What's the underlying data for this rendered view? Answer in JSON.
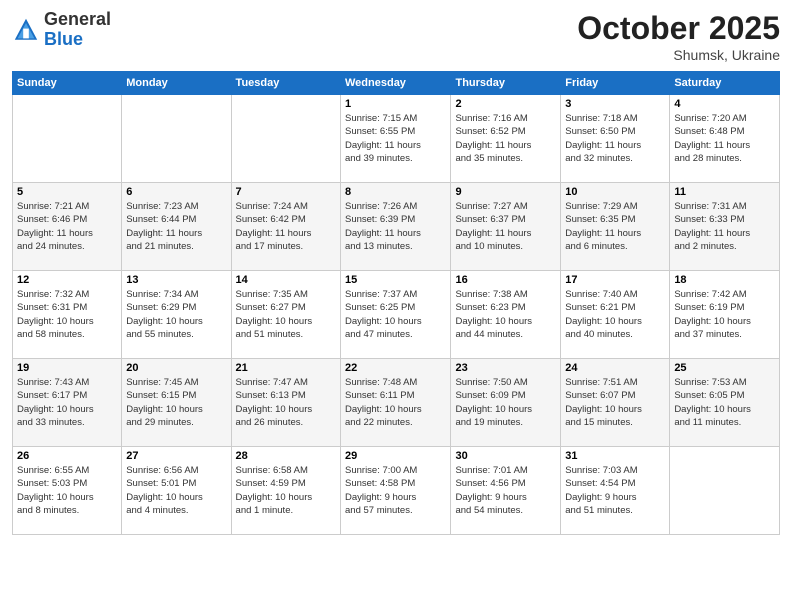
{
  "header": {
    "logo_general": "General",
    "logo_blue": "Blue",
    "month_title": "October 2025",
    "location": "Shumsk, Ukraine"
  },
  "days_of_week": [
    "Sunday",
    "Monday",
    "Tuesday",
    "Wednesday",
    "Thursday",
    "Friday",
    "Saturday"
  ],
  "weeks": [
    [
      {
        "day": "",
        "info": ""
      },
      {
        "day": "",
        "info": ""
      },
      {
        "day": "",
        "info": ""
      },
      {
        "day": "1",
        "info": "Sunrise: 7:15 AM\nSunset: 6:55 PM\nDaylight: 11 hours\nand 39 minutes."
      },
      {
        "day": "2",
        "info": "Sunrise: 7:16 AM\nSunset: 6:52 PM\nDaylight: 11 hours\nand 35 minutes."
      },
      {
        "day": "3",
        "info": "Sunrise: 7:18 AM\nSunset: 6:50 PM\nDaylight: 11 hours\nand 32 minutes."
      },
      {
        "day": "4",
        "info": "Sunrise: 7:20 AM\nSunset: 6:48 PM\nDaylight: 11 hours\nand 28 minutes."
      }
    ],
    [
      {
        "day": "5",
        "info": "Sunrise: 7:21 AM\nSunset: 6:46 PM\nDaylight: 11 hours\nand 24 minutes."
      },
      {
        "day": "6",
        "info": "Sunrise: 7:23 AM\nSunset: 6:44 PM\nDaylight: 11 hours\nand 21 minutes."
      },
      {
        "day": "7",
        "info": "Sunrise: 7:24 AM\nSunset: 6:42 PM\nDaylight: 11 hours\nand 17 minutes."
      },
      {
        "day": "8",
        "info": "Sunrise: 7:26 AM\nSunset: 6:39 PM\nDaylight: 11 hours\nand 13 minutes."
      },
      {
        "day": "9",
        "info": "Sunrise: 7:27 AM\nSunset: 6:37 PM\nDaylight: 11 hours\nand 10 minutes."
      },
      {
        "day": "10",
        "info": "Sunrise: 7:29 AM\nSunset: 6:35 PM\nDaylight: 11 hours\nand 6 minutes."
      },
      {
        "day": "11",
        "info": "Sunrise: 7:31 AM\nSunset: 6:33 PM\nDaylight: 11 hours\nand 2 minutes."
      }
    ],
    [
      {
        "day": "12",
        "info": "Sunrise: 7:32 AM\nSunset: 6:31 PM\nDaylight: 10 hours\nand 58 minutes."
      },
      {
        "day": "13",
        "info": "Sunrise: 7:34 AM\nSunset: 6:29 PM\nDaylight: 10 hours\nand 55 minutes."
      },
      {
        "day": "14",
        "info": "Sunrise: 7:35 AM\nSunset: 6:27 PM\nDaylight: 10 hours\nand 51 minutes."
      },
      {
        "day": "15",
        "info": "Sunrise: 7:37 AM\nSunset: 6:25 PM\nDaylight: 10 hours\nand 47 minutes."
      },
      {
        "day": "16",
        "info": "Sunrise: 7:38 AM\nSunset: 6:23 PM\nDaylight: 10 hours\nand 44 minutes."
      },
      {
        "day": "17",
        "info": "Sunrise: 7:40 AM\nSunset: 6:21 PM\nDaylight: 10 hours\nand 40 minutes."
      },
      {
        "day": "18",
        "info": "Sunrise: 7:42 AM\nSunset: 6:19 PM\nDaylight: 10 hours\nand 37 minutes."
      }
    ],
    [
      {
        "day": "19",
        "info": "Sunrise: 7:43 AM\nSunset: 6:17 PM\nDaylight: 10 hours\nand 33 minutes."
      },
      {
        "day": "20",
        "info": "Sunrise: 7:45 AM\nSunset: 6:15 PM\nDaylight: 10 hours\nand 29 minutes."
      },
      {
        "day": "21",
        "info": "Sunrise: 7:47 AM\nSunset: 6:13 PM\nDaylight: 10 hours\nand 26 minutes."
      },
      {
        "day": "22",
        "info": "Sunrise: 7:48 AM\nSunset: 6:11 PM\nDaylight: 10 hours\nand 22 minutes."
      },
      {
        "day": "23",
        "info": "Sunrise: 7:50 AM\nSunset: 6:09 PM\nDaylight: 10 hours\nand 19 minutes."
      },
      {
        "day": "24",
        "info": "Sunrise: 7:51 AM\nSunset: 6:07 PM\nDaylight: 10 hours\nand 15 minutes."
      },
      {
        "day": "25",
        "info": "Sunrise: 7:53 AM\nSunset: 6:05 PM\nDaylight: 10 hours\nand 11 minutes."
      }
    ],
    [
      {
        "day": "26",
        "info": "Sunrise: 6:55 AM\nSunset: 5:03 PM\nDaylight: 10 hours\nand 8 minutes."
      },
      {
        "day": "27",
        "info": "Sunrise: 6:56 AM\nSunset: 5:01 PM\nDaylight: 10 hours\nand 4 minutes."
      },
      {
        "day": "28",
        "info": "Sunrise: 6:58 AM\nSunset: 4:59 PM\nDaylight: 10 hours\nand 1 minute."
      },
      {
        "day": "29",
        "info": "Sunrise: 7:00 AM\nSunset: 4:58 PM\nDaylight: 9 hours\nand 57 minutes."
      },
      {
        "day": "30",
        "info": "Sunrise: 7:01 AM\nSunset: 4:56 PM\nDaylight: 9 hours\nand 54 minutes."
      },
      {
        "day": "31",
        "info": "Sunrise: 7:03 AM\nSunset: 4:54 PM\nDaylight: 9 hours\nand 51 minutes."
      },
      {
        "day": "",
        "info": ""
      }
    ]
  ]
}
